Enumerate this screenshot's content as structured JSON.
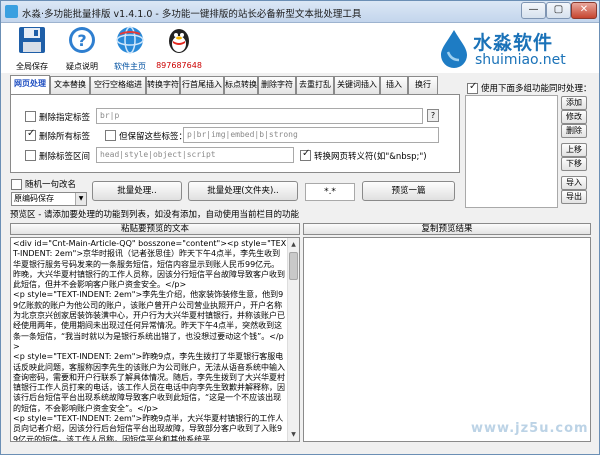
{
  "window": {
    "title": "水淼·多功能批量排版 v1.4.1.0 - 多功能一键排版的站长必备新型文本批处理工具",
    "minimize": "—",
    "maximize": "▢",
    "close": "✕"
  },
  "toolbar": {
    "save": "全局保存",
    "help": "疑点说明",
    "home": "软件主页",
    "qq": "897687648"
  },
  "logo": {
    "brand": "水淼软件",
    "site": "shuimiao.net"
  },
  "tabs": [
    "网页处理",
    "文本替换",
    "空行空格缩进",
    "转换字符",
    "行首尾插入",
    "标点转换",
    "删除字符",
    "去重打乱",
    "关键词插入",
    "插入",
    "换行"
  ],
  "options": {
    "remove_tags_label": "删除指定标签",
    "remove_tags_value": "br|p",
    "remove_all_label": "删除所有标签",
    "keep_tags_label": "但保留这些标签：",
    "keep_tags_value": "p|br|img|embed|b|strong",
    "remove_zone_label": "删除标签区间",
    "remove_zone_value": "head|style|object|script",
    "convert_entity_label": "转换网页转义符(如\"&nbsp;\")",
    "help_btn": "?"
  },
  "right": {
    "use_all_label": "使用下面多组功能同时处理：",
    "buttons": [
      "添加",
      "修改",
      "删除",
      "上移",
      "下移",
      "导入",
      "导出"
    ]
  },
  "process": {
    "random_label": "随机一句改名",
    "random_select": "原编码保存",
    "batch_btn": "批量处理..",
    "batch_folder_btn": "批量处理(文件夹)..",
    "ext_value": "*.*",
    "preview_btn": "预览一篇"
  },
  "hint": "预览区 - 请添加要处理的功能到列表，如没有添加，自动使用当前栏目的功能",
  "panes": {
    "left_title": "粘贴要预览的文本",
    "right_title": "复制预览结果",
    "source_text": "<div id=\"Cnt-Main-Article-QQ\" bosszone=\"content\"><p style=\"TEXT-INDENT: 2em\">京华时报讯（记者张思佳）昨天下午4点半，李先生收到华夏银行服务号码发来的一条服务短信，短信内容显示到账人民币99亿元。昨晚，大兴华夏村镇银行的工作人员称，因该分行短信平台故障导致客户收到此短信，但并不会影响客户账户资金安全。</p>\n<p style=\"TEXT-INDENT: 2em\">李先生介绍，他家装饰装修生意，他到99亿账款的账户为他公司的账户，该账户曾开户公司营业执照开户，开户名称为北京京兴创家居装饰装潢中心，开户行为大兴华夏村镇银行，并称该账户已经使用两年，使用期间未出现过任何异常情况。昨天下午4点半，突然收到这条一条短信，“我当时就以为是银行系统出错了，也没想过要动这个钱”。</p>\n<p style=\"TEXT-INDENT: 2em\">昨晚9点，李先生拨打了华夏银行客服电话反映此问题，客服称因李先生的该账户为公司账户，无法从语音系统中输入查询密码，需要和开户行联系了解具体情况。随后，李先生拨到了大兴华夏村镇银行工作人员打来的电话，该工作人员在电话中向李先生致歉并解释称，因该行后台短信平台出现系统故障导致客户收到此短信，“这是一个不应该出现的短信，不会影响账户资金安全”。</p>\n<p style=\"TEXT-INDENT: 2em\">昨晚9点半，大兴华夏村镇银行的工作人员向记者介绍，因该分行后台短信平台出现故障，导致部分客户收到了入账99亿元的短信。该工作人员称，因短信平台和其他系统平"
  },
  "watermark": "www.jz5u.com"
}
